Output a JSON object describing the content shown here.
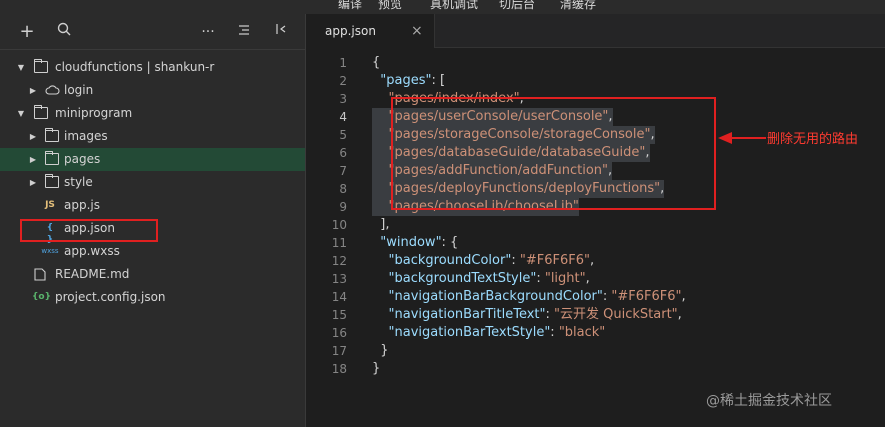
{
  "menu": [
    "编译",
    "预览",
    "真机调试",
    "切后台",
    "清缓存"
  ],
  "sidebar": {
    "tree": [
      {
        "label": "cloudfunctions | shankun-r",
        "depth": 0,
        "arrow": "▼",
        "icon": "cloud-folder-icon"
      },
      {
        "label": "login",
        "depth": 1,
        "arrow": "▶",
        "icon": "cloud-icon"
      },
      {
        "label": "miniprogram",
        "depth": 0,
        "arrow": "▼",
        "icon": "folder-open-icon"
      },
      {
        "label": "images",
        "depth": 1,
        "arrow": "▶",
        "icon": "folder-icon"
      },
      {
        "label": "pages",
        "depth": 1,
        "arrow": "▶",
        "icon": "folder-icon",
        "selected": true
      },
      {
        "label": "style",
        "depth": 1,
        "arrow": "▶",
        "icon": "folder-icon"
      },
      {
        "label": "app.js",
        "depth": 1,
        "arrow": "",
        "icon": "js-file-icon",
        "glyph": "JS"
      },
      {
        "label": "app.json",
        "depth": 1,
        "arrow": "",
        "icon": "json-file-icon",
        "glyph": "{ }"
      },
      {
        "label": "app.wxss",
        "depth": 1,
        "arrow": "",
        "icon": "wxss-file-icon",
        "glyph": "wxss"
      },
      {
        "label": "README.md",
        "depth": 0,
        "arrow": "",
        "icon": "file-icon"
      },
      {
        "label": "project.config.json",
        "depth": 0,
        "arrow": "",
        "icon": "config-file-icon",
        "glyph": "{o}"
      }
    ]
  },
  "editor": {
    "tab": {
      "name": "app.json",
      "close": "×"
    },
    "current_line": 4,
    "lines": [
      {
        "n": "1",
        "tokens": [
          [
            "p",
            "{"
          ]
        ]
      },
      {
        "n": "2",
        "tokens": [
          [
            "k",
            "  \"pages\""
          ],
          [
            "p",
            ": ["
          ]
        ]
      },
      {
        "n": "3",
        "tokens": [
          [
            "s",
            "    \"pages/index/index\""
          ],
          [
            "p",
            ","
          ]
        ]
      },
      {
        "n": "4",
        "tokens": [
          [
            "s",
            "    \"pages/userConsole/userConsole\""
          ],
          [
            "p",
            ","
          ]
        ],
        "sel": true
      },
      {
        "n": "5",
        "tokens": [
          [
            "s",
            "    \"pages/storageConsole/storageConsole\""
          ],
          [
            "p",
            ","
          ]
        ],
        "sel": true
      },
      {
        "n": "6",
        "tokens": [
          [
            "s",
            "    \"pages/databaseGuide/databaseGuide\""
          ],
          [
            "p",
            ","
          ]
        ],
        "sel": true
      },
      {
        "n": "7",
        "tokens": [
          [
            "s",
            "    \"pages/addFunction/addFunction\""
          ],
          [
            "p",
            ","
          ]
        ],
        "sel": true
      },
      {
        "n": "8",
        "tokens": [
          [
            "s",
            "    \"pages/deployFunctions/deployFunctions\""
          ],
          [
            "p",
            ","
          ]
        ],
        "sel": true
      },
      {
        "n": "9",
        "tokens": [
          [
            "s",
            "    \"pages/chooseLib/chooseLib\""
          ]
        ],
        "sel": true
      },
      {
        "n": "10",
        "tokens": [
          [
            "p",
            "  ],"
          ]
        ]
      },
      {
        "n": "11",
        "tokens": [
          [
            "k",
            "  \"window\""
          ],
          [
            "p",
            ": {"
          ]
        ]
      },
      {
        "n": "12",
        "tokens": [
          [
            "k",
            "    \"backgroundColor\""
          ],
          [
            "p",
            ": "
          ],
          [
            "s",
            "\"#F6F6F6\""
          ],
          [
            "p",
            ","
          ]
        ]
      },
      {
        "n": "13",
        "tokens": [
          [
            "k",
            "    \"backgroundTextStyle\""
          ],
          [
            "p",
            ": "
          ],
          [
            "s",
            "\"light\""
          ],
          [
            "p",
            ","
          ]
        ]
      },
      {
        "n": "14",
        "tokens": [
          [
            "k",
            "    \"navigationBarBackgroundColor\""
          ],
          [
            "p",
            ": "
          ],
          [
            "s",
            "\"#F6F6F6\""
          ],
          [
            "p",
            ","
          ]
        ]
      },
      {
        "n": "15",
        "tokens": [
          [
            "k",
            "    \"navigationBarTitleText\""
          ],
          [
            "p",
            ": "
          ],
          [
            "s",
            "\"云开发 QuickStart\""
          ],
          [
            "p",
            ","
          ]
        ]
      },
      {
        "n": "16",
        "tokens": [
          [
            "k",
            "    \"navigationBarTextStyle\""
          ],
          [
            "p",
            ": "
          ],
          [
            "s",
            "\"black\""
          ]
        ]
      },
      {
        "n": "17",
        "tokens": [
          [
            "p",
            "  }"
          ]
        ]
      },
      {
        "n": "18",
        "tokens": [
          [
            "p",
            "}"
          ]
        ]
      }
    ]
  },
  "annotation": {
    "text": "删除无用的路由",
    "color": "#ff3b30"
  },
  "watermark": "@稀土掘金技术社区",
  "colors": {
    "selected_row": "#234a36",
    "key": "#9cdcfe",
    "string": "#ce9178",
    "annotation_red": "#e02020"
  }
}
